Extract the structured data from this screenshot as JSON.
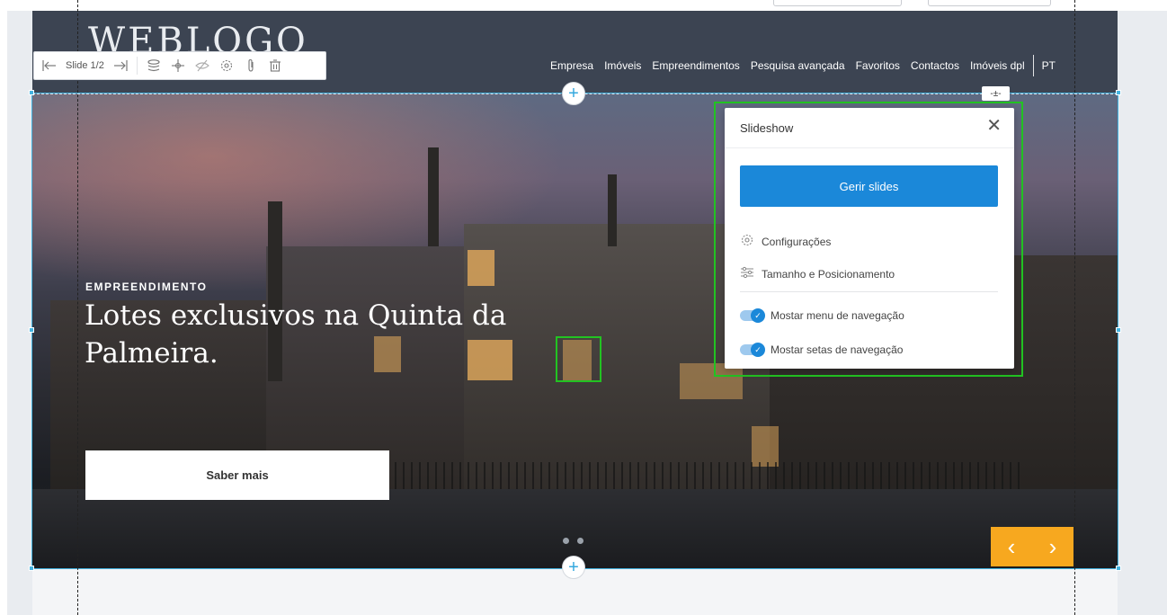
{
  "site": {
    "logo": "WEBLOGO",
    "nav": [
      "Empresa",
      "Imóveis",
      "Empreendimentos",
      "Pesquisa avançada",
      "Favoritos",
      "Contactos",
      "Imóveis dpl"
    ],
    "language": "PT"
  },
  "toolbar": {
    "slide_label": "Slide 1/2",
    "icons": [
      "arrow-left-icon",
      "arrow-right-icon",
      "layers-icon",
      "move-icon",
      "hide-icon",
      "settings-icon",
      "attachment-icon",
      "trash-icon"
    ]
  },
  "hero": {
    "eyebrow": "EMPREENDIMENTO",
    "headline": "Lotes exclusivos na Quinta da Palmeira.",
    "cta_label": "Saber mais",
    "prev_arrow": "‹",
    "next_arrow": "›"
  },
  "editor": {
    "add_section_symbol": "+",
    "small_button": "-±-"
  },
  "panel": {
    "title": "Slideshow",
    "close_symbol": "✕",
    "primary_button": "Gerir slides",
    "options": [
      {
        "icon": "gear-icon",
        "label": "Configurações"
      },
      {
        "icon": "sliders-icon",
        "label": "Tamanho e Posicionamento"
      }
    ],
    "toggles": [
      {
        "label": "Mostar menu de navegação",
        "on": true
      },
      {
        "label": "Mostar setas de navegação",
        "on": true
      }
    ]
  },
  "colors": {
    "header_bg": "#3c4452",
    "primary_blue": "#1b88d9",
    "accent_orange": "#f7a81f",
    "selection_outline": "#44b3e0",
    "highlight_green": "#22c322"
  }
}
